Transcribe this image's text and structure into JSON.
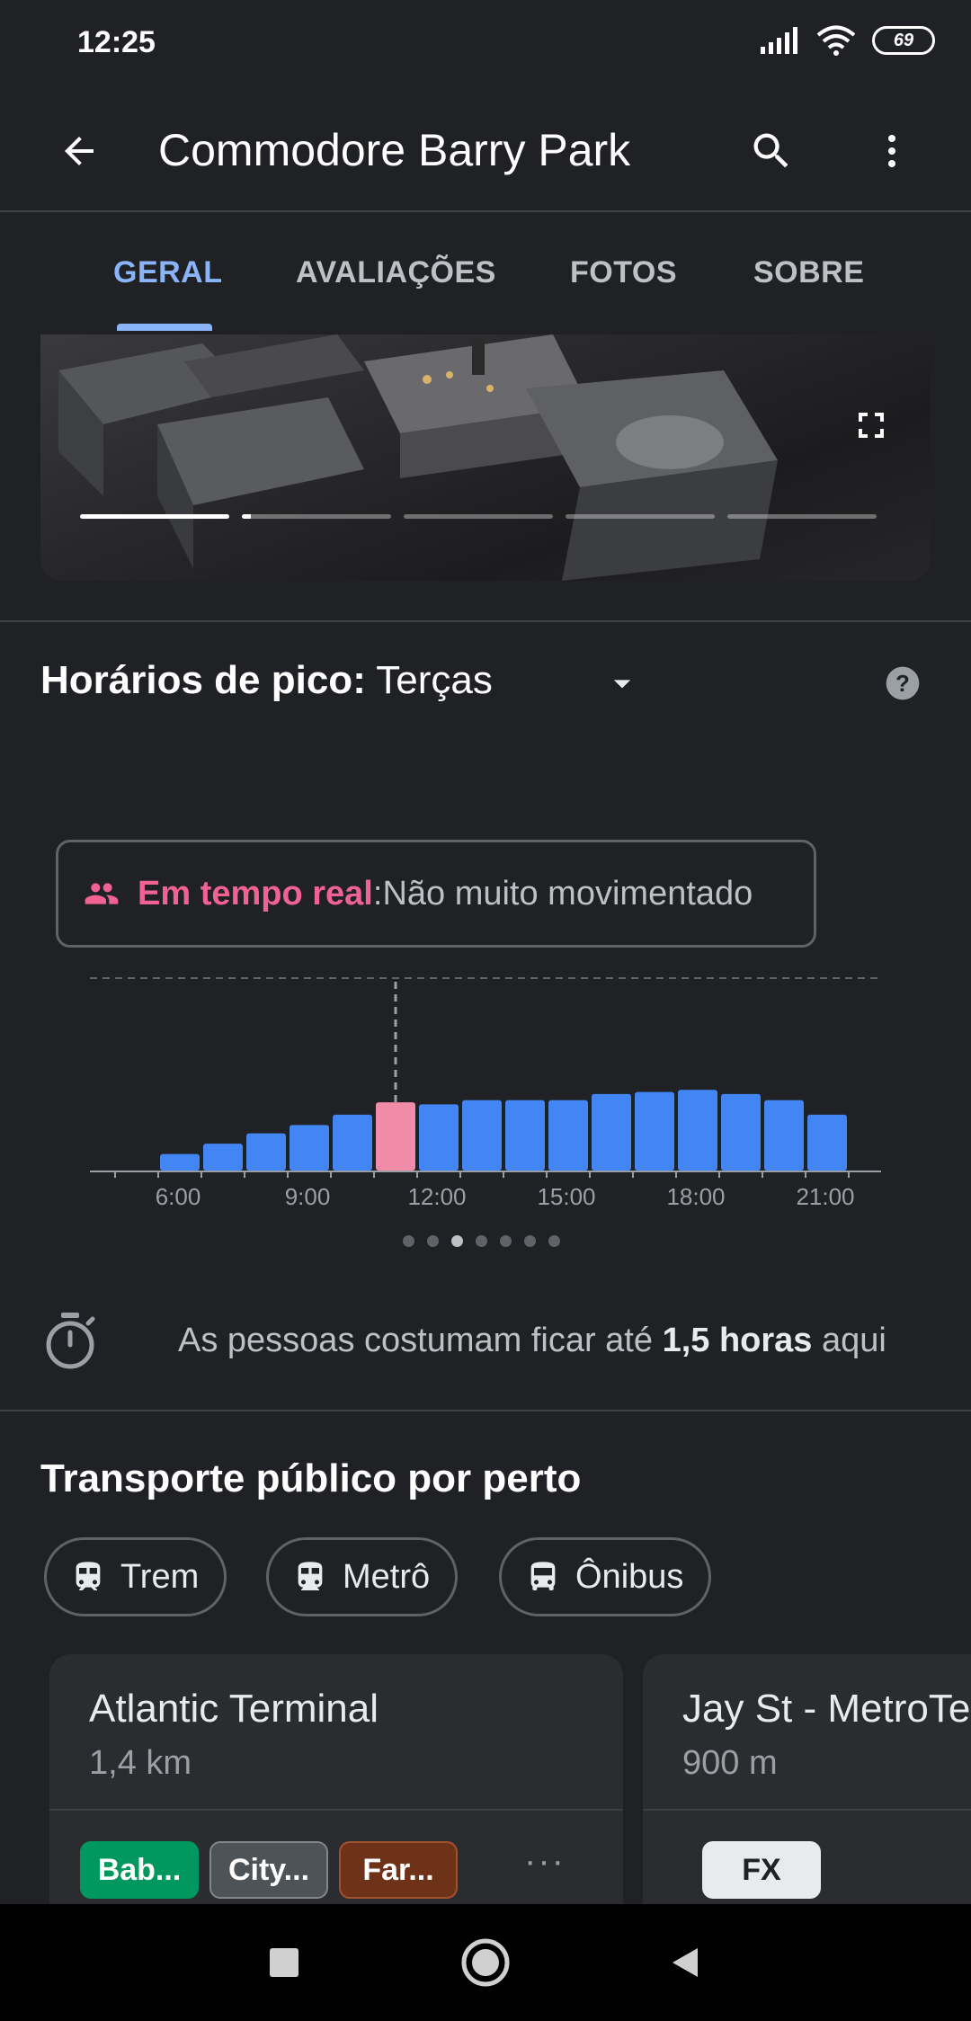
{
  "status_bar": {
    "time": "12:25",
    "battery": "69"
  },
  "app_bar": {
    "title": "Commodore Barry Park"
  },
  "tabs": [
    {
      "label": "GERAL",
      "active": true
    },
    {
      "label": "AVALIAÇÕES",
      "active": false
    },
    {
      "label": "FOTOS",
      "active": false
    },
    {
      "label": "SOBRE",
      "active": false
    }
  ],
  "photo": {
    "page_count": 5,
    "current_page": 1
  },
  "popular_times": {
    "heading": "Horários de pico:",
    "day": "Terças",
    "live_label": "Em tempo real",
    "live_separator": ": ",
    "live_value": "Não muito movimentado",
    "carousel_page": 3,
    "carousel_count": 7
  },
  "chart_data": {
    "type": "bar",
    "x_tick_labels": [
      "6:00",
      "9:00",
      "12:00",
      "15:00",
      "18:00",
      "21:00"
    ],
    "categories": [
      "6",
      "7",
      "8",
      "9",
      "10",
      "11",
      "12",
      "13",
      "14",
      "15",
      "16",
      "17",
      "18",
      "19",
      "20",
      "21"
    ],
    "values": [
      8,
      13,
      18,
      22,
      27,
      33,
      32,
      34,
      34,
      34,
      37,
      38,
      39,
      37,
      34,
      27
    ],
    "live_hour": "11",
    "ylim": [
      0,
      100
    ],
    "colors": {
      "bar": "#4285f4",
      "live": "#f28ba8",
      "axis": "#9aa0a6"
    }
  },
  "duration": {
    "prefix": "As pessoas costumam ficar até ",
    "bold": "1,5 horas",
    "suffix": " aqui"
  },
  "transit": {
    "heading": "Transporte público por perto",
    "chips": [
      {
        "label": "Trem",
        "icon": "train-icon"
      },
      {
        "label": "Metrô",
        "icon": "subway-icon"
      },
      {
        "label": "Ônibus",
        "icon": "bus-icon"
      }
    ],
    "stations": [
      {
        "name": "Atlantic Terminal",
        "distance": "1,4 km",
        "lines": [
          {
            "label": "Bab...",
            "bg": "#00985f",
            "fg": "#ffffff"
          },
          {
            "label": "City...",
            "bg": "#4d5357",
            "fg": "#ffffff"
          },
          {
            "label": "Far...",
            "bg": "#6e3219",
            "fg": "#ffffff"
          }
        ],
        "more": "···"
      },
      {
        "name": "Jay St - MetroTech",
        "distance": "900 m",
        "lines": [
          {
            "label": "FX",
            "bg": "#e8eaed",
            "fg": "#202124"
          }
        ]
      }
    ]
  }
}
